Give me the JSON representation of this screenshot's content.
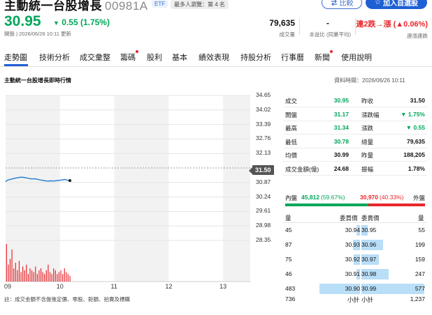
{
  "header": {
    "name": "主動統一台股增長",
    "code": "00981A",
    "etf_badge": "ETF",
    "rank_badge": "最多人瀏覽：第 4 名",
    "compare_label": "比較",
    "watch_label": "加入自選股"
  },
  "quote": {
    "price": "30.95",
    "change": "0.55 (1.75%)",
    "change_direction": "down",
    "subinfo": "開盤 | 2026/06/26 10:11 更新",
    "stats": [
      {
        "value": "79,635",
        "label": "成交量"
      },
      {
        "value": "-",
        "label": "本益比 (同業平均)"
      },
      {
        "value": "連2跌→漲 (▲0.06%)",
        "label": "連漲連跌"
      }
    ]
  },
  "tabs": [
    "走勢圖",
    "技術分析",
    "成交彙整",
    "籌碼",
    "股利",
    "基本",
    "績效表現",
    "持股分析",
    "行事曆",
    "新聞",
    "使用說明"
  ],
  "section": {
    "title": "主動統一台股增長即時行情",
    "data_time": "資料時間：2026/06/26 10:11"
  },
  "chart_data": {
    "type": "line",
    "x_ticks": [
      "09",
      "10",
      "11",
      "12",
      "13"
    ],
    "y_ticks": [
      34.65,
      34.02,
      33.39,
      32.76,
      32.13,
      31.5,
      30.87,
      30.24,
      29.61,
      28.98,
      28.35
    ],
    "ylim": [
      28.35,
      34.65
    ],
    "reference_price": 31.5,
    "price_series": {
      "x_minutes_from_0900": [
        0,
        2,
        5,
        8,
        11,
        14,
        17,
        20,
        23,
        26,
        29,
        32,
        35,
        38,
        41,
        44,
        47,
        50,
        53,
        56,
        59,
        62,
        65,
        68,
        71
      ],
      "price": [
        30.9,
        30.97,
        31.0,
        31.03,
        31.06,
        31.08,
        31.1,
        31.09,
        31.07,
        31.04,
        31.02,
        31.03,
        31.01,
        30.98,
        30.96,
        30.94,
        30.93,
        30.94,
        30.93,
        30.95,
        30.96,
        30.98,
        31.0,
        30.97,
        30.95
      ]
    },
    "volume_series": {
      "x_minutes_from_0900": [
        1,
        3,
        5,
        7,
        9,
        11,
        13,
        15,
        17,
        19,
        21,
        23,
        25,
        27,
        29,
        31,
        33,
        35,
        37,
        39,
        41,
        43,
        45,
        47,
        49,
        51,
        53,
        55,
        57,
        59,
        61,
        63,
        65,
        67,
        69,
        71
      ],
      "volume_relative": [
        1.0,
        0.45,
        0.6,
        0.85,
        0.35,
        0.5,
        0.3,
        0.55,
        0.25,
        0.4,
        0.3,
        0.45,
        0.2,
        0.35,
        0.3,
        0.25,
        0.4,
        0.2,
        0.3,
        0.35,
        0.25,
        0.2,
        0.3,
        0.45,
        0.25,
        0.2,
        0.35,
        0.3,
        0.2,
        0.25,
        0.3,
        0.2,
        0.35,
        0.25,
        0.2,
        0.15
      ]
    },
    "line_color": "#2f80d1",
    "volume_color": "#e8262b"
  },
  "ref_tag": "31.50",
  "footnote": "註：成交金額不含盤後定價、零股、鉅額、拍賣及標購",
  "quote_table": [
    {
      "k1": "成交",
      "v1": "30.95",
      "c1": "green",
      "k2": "昨收",
      "v2": "31.50",
      "c2": "black"
    },
    {
      "k1": "開盤",
      "v1": "31.17",
      "c1": "green",
      "k2": "漲跌幅",
      "v2": "▼ 1.75%",
      "c2": "green"
    },
    {
      "k1": "最高",
      "v1": "31.34",
      "c1": "green",
      "k2": "漲跌",
      "v2": "▼ 0.55",
      "c2": "green"
    },
    {
      "k1": "最低",
      "v1": "30.78",
      "c1": "green",
      "k2": "總量",
      "v2": "79,635",
      "c2": "black"
    },
    {
      "k1": "均價",
      "v1": "30.99",
      "c1": "black",
      "k2": "昨量",
      "v2": "188,205",
      "c2": "black"
    },
    {
      "k1": "成交金額(億)",
      "v1": "24.68",
      "c1": "black",
      "k2": "振幅",
      "v2": "1.78%",
      "c2": "black"
    }
  ],
  "inout": {
    "in_label": "內盤",
    "in_value": "45,812",
    "in_pct": "(59.67%)",
    "out_value": "30,970",
    "out_pct": "(40.33%)",
    "out_label": "外盤",
    "in_fraction": 0.5967
  },
  "orderbook": {
    "headers": [
      "量",
      "委買價",
      "委賣價",
      "量"
    ],
    "rows": [
      {
        "bid_vol": "45",
        "bid_price": "30.94",
        "ask_price": "30.95",
        "ask_vol": "55",
        "bid_frac": 0.093,
        "ask_frac": 0.095
      },
      {
        "bid_vol": "87",
        "bid_price": "30.93",
        "ask_price": "30.96",
        "ask_vol": "199",
        "bid_frac": 0.18,
        "ask_frac": 0.345
      },
      {
        "bid_vol": "75",
        "bid_price": "30.92",
        "ask_price": "30.97",
        "ask_vol": "159",
        "bid_frac": 0.155,
        "ask_frac": 0.275
      },
      {
        "bid_vol": "46",
        "bid_price": "30.91",
        "ask_price": "30.98",
        "ask_vol": "247",
        "bid_frac": 0.095,
        "ask_frac": 0.428
      },
      {
        "bid_vol": "483",
        "bid_price": "30.90",
        "ask_price": "30.99",
        "ask_vol": "577",
        "bid_frac": 1.0,
        "ask_frac": 1.0
      }
    ],
    "bid_total": "736",
    "bid_total_label": "小計",
    "ask_total_label": "小計",
    "ask_total": "1,237"
  }
}
